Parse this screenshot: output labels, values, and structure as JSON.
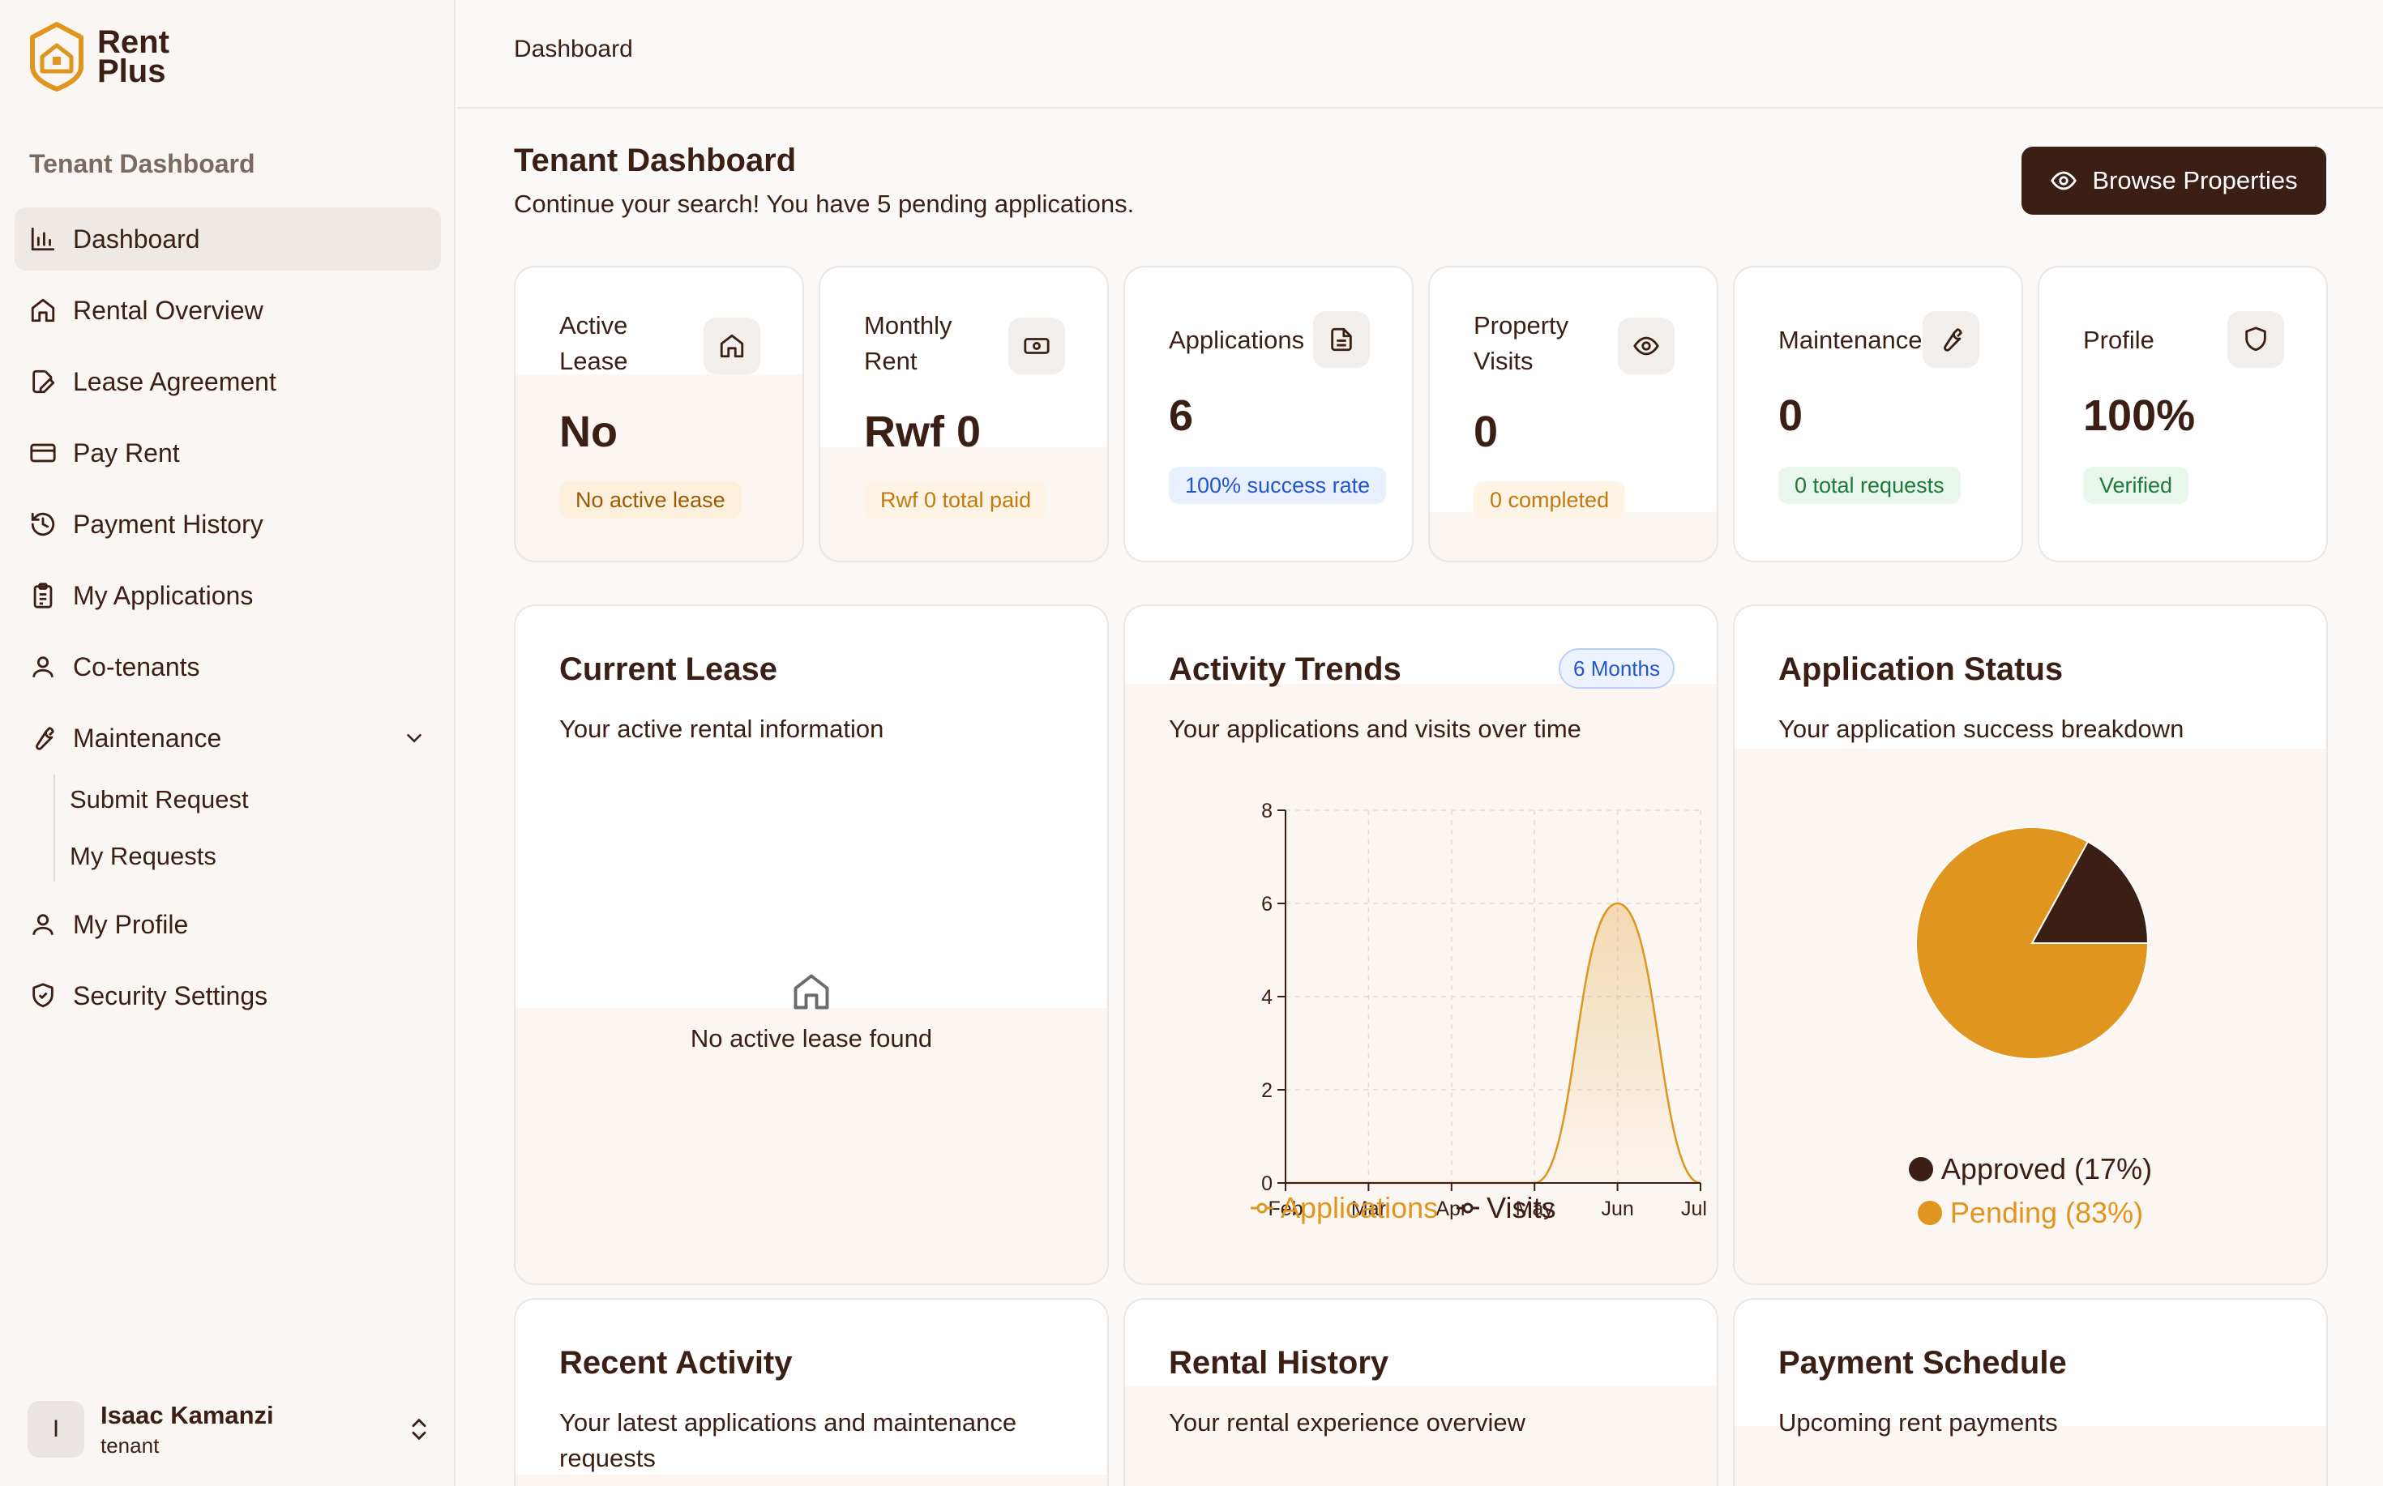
{
  "brand": {
    "name_line1": "Rent",
    "name_line2": "Plus"
  },
  "sidebar": {
    "section_title": "Tenant Dashboard",
    "items": [
      {
        "label": "Dashboard",
        "icon": "bar-chart-icon"
      },
      {
        "label": "Rental Overview",
        "icon": "home-icon"
      },
      {
        "label": "Lease Agreement",
        "icon": "file-edit-icon"
      },
      {
        "label": "Pay Rent",
        "icon": "credit-card-icon"
      },
      {
        "label": "Payment History",
        "icon": "history-icon"
      },
      {
        "label": "My Applications",
        "icon": "clipboard-icon"
      },
      {
        "label": "Co-tenants",
        "icon": "user-icon"
      },
      {
        "label": "Maintenance",
        "icon": "wrench-icon"
      },
      {
        "label": "My Profile",
        "icon": "user-icon"
      },
      {
        "label": "Security Settings",
        "icon": "shield-icon"
      }
    ],
    "maintenance_sub": [
      "Submit Request",
      "My Requests"
    ]
  },
  "user": {
    "initial": "I",
    "name": "Isaac Kamanzi",
    "role": "tenant"
  },
  "header": {
    "breadcrumb": "Dashboard"
  },
  "page": {
    "title": "Tenant Dashboard",
    "subtitle": "Continue your search! You have 5 pending applications.",
    "browse_button": "Browse Properties"
  },
  "stats": [
    {
      "label_line1": "Active",
      "label_line2": "Lease",
      "value": "No",
      "badge": "No active lease",
      "icon": "home-icon"
    },
    {
      "label_line1": "Monthly",
      "label_line2": "Rent",
      "value": "Rwf 0",
      "badge": "Rwf 0 total paid",
      "icon": "banknote-icon"
    },
    {
      "label_line1": "Applications",
      "value": "6",
      "badge": "100% success rate",
      "icon": "file-text-icon"
    },
    {
      "label_line1": "Property",
      "label_line2": "Visits",
      "value": "0",
      "badge": "0 completed",
      "icon": "eye-icon"
    },
    {
      "label_line1": "Maintenance",
      "value": "0",
      "badge": "0 total requests",
      "icon": "wrench-icon"
    },
    {
      "label_line1": "Profile",
      "value": "100%",
      "badge": "Verified",
      "icon": "shield-icon"
    }
  ],
  "lease_card": {
    "title": "Current Lease",
    "subtitle": "Your active rental information",
    "empty_text": "No active lease found"
  },
  "trends_card": {
    "title": "Activity Trends",
    "subtitle": "Your applications and visits over time",
    "range_pill": "6 Months"
  },
  "status_card": {
    "title": "Application Status",
    "subtitle": "Your application success breakdown"
  },
  "recent_card": {
    "title": "Recent Activity",
    "subtitle": "Your latest applications and maintenance requests"
  },
  "history_card": {
    "title": "Rental History",
    "subtitle": "Your rental experience overview"
  },
  "schedule_card": {
    "title": "Payment Schedule",
    "subtitle": "Upcoming rent payments"
  },
  "colors": {
    "brand_dark": "#3b1f14",
    "accent": "#e0961e"
  },
  "chart_data": [
    {
      "type": "area",
      "categories": [
        "Feb",
        "Mar",
        "Apr",
        "May",
        "Jun",
        "Jul"
      ],
      "series": [
        {
          "name": "Applications",
          "values": [
            0,
            0,
            0,
            0,
            6,
            0
          ],
          "color": "#e0961e"
        },
        {
          "name": "Visits",
          "values": [
            0,
            0,
            0,
            0,
            0,
            0
          ],
          "color": "#3b1f14"
        }
      ],
      "yticks": [
        "0",
        "2",
        "4",
        "6",
        "8"
      ],
      "ylim": [
        0,
        8
      ],
      "grid": true,
      "legend": "bottom"
    },
    {
      "type": "pie",
      "slices": [
        {
          "label": "Approved (17%)",
          "value": 17,
          "color": "#3b1f14"
        },
        {
          "label": "Pending (83%)",
          "value": 83,
          "color": "#e0961e"
        }
      ],
      "legend": "bottom"
    }
  ]
}
